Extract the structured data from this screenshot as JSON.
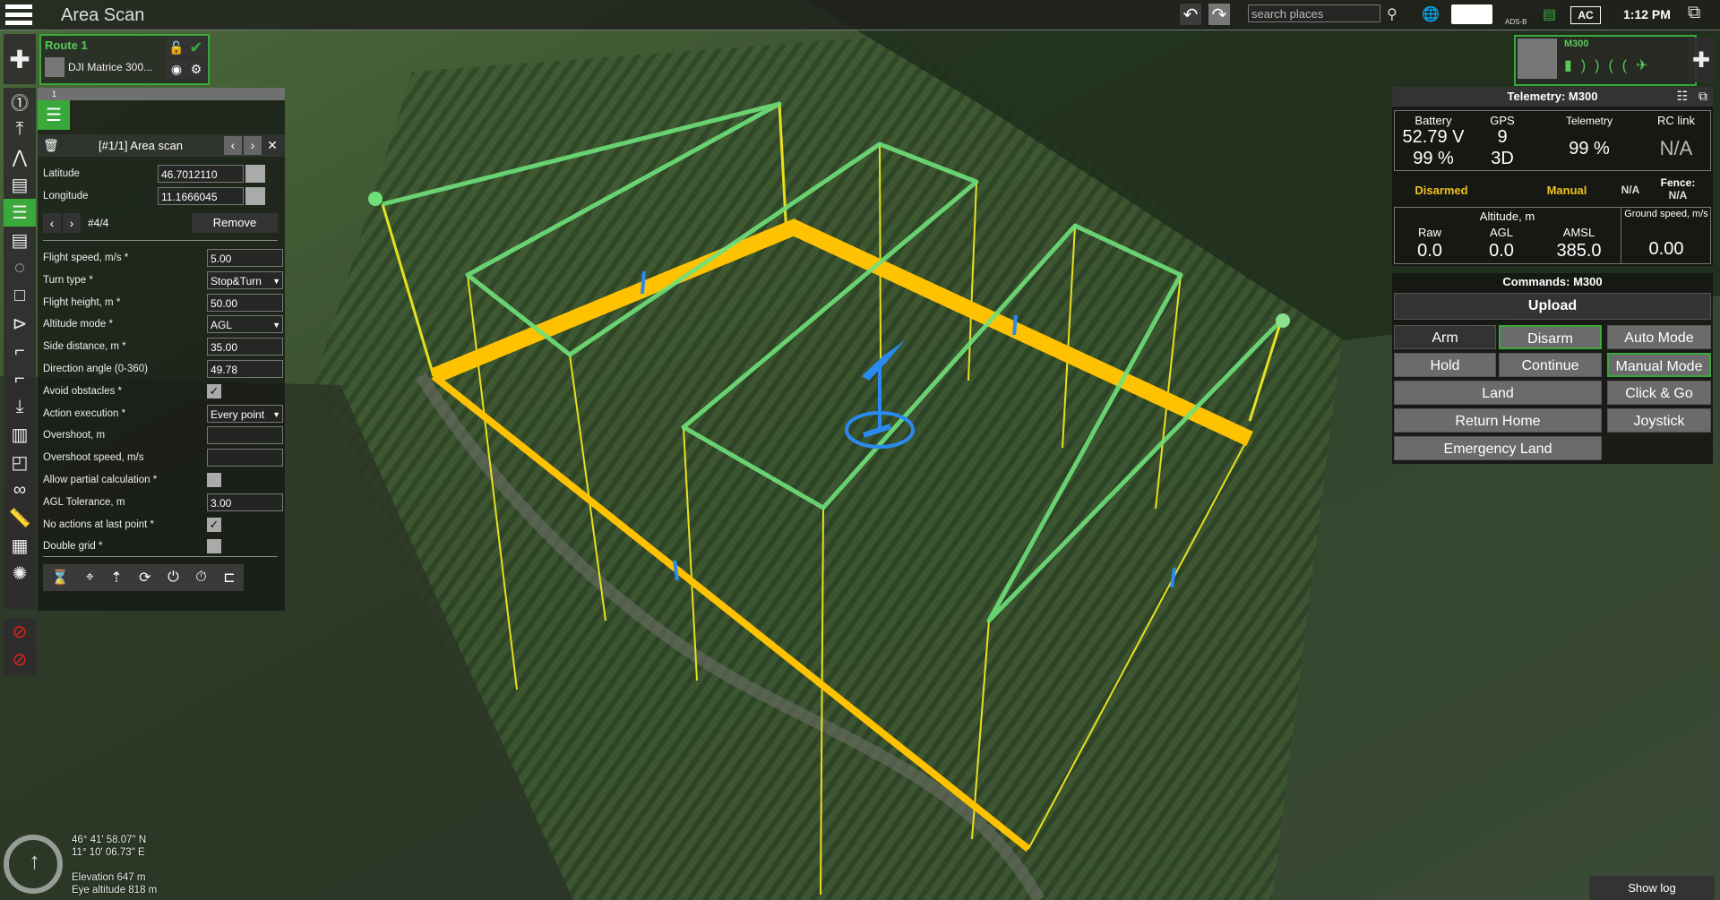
{
  "app": {
    "title": "Area Scan"
  },
  "topbar": {
    "search_placeholder": "search places",
    "ac_label": "AC",
    "time": "1:12 PM",
    "icons": [
      "undo-icon",
      "redo-icon",
      "search-icon",
      "globe-icon",
      "keyboard-icon",
      "adsb-icon",
      "checklist-icon",
      "battery-ac-icon",
      "mission-hub-icon"
    ],
    "adsb_label": "ADS-B"
  },
  "route": {
    "name": "Route 1",
    "drone": "DJI Matrice 300..."
  },
  "left_tools": [
    "add-route",
    "waypoint-1",
    "takeoff",
    "polyline",
    "area-scan-photo",
    "area-scan",
    "area-scan-lidar",
    "circle",
    "rectangle",
    "facade-scan",
    "corridor-photo",
    "corridor-lidar",
    "landing",
    "grid-scan",
    "spiral",
    "double-circle",
    "ruler",
    "overlay",
    "light",
    "no-fly-zone-square",
    "no-fly-zone-circle"
  ],
  "panel": {
    "tab_index": "1",
    "title": "[#1/1] Area scan",
    "latitude_label": "Latitude",
    "latitude": "46.7012110",
    "longitude_label": "Longitude",
    "longitude": "11.1666045",
    "point_counter": "#4/4",
    "remove_label": "Remove",
    "fields": [
      {
        "label": "Flight speed, m/s *",
        "value": "5.00",
        "type": "text"
      },
      {
        "label": "Turn type *",
        "value": "Stop&Turn",
        "type": "select"
      },
      {
        "label": "Flight height, m *",
        "value": "50.00",
        "type": "text"
      },
      {
        "label": "Altitude mode *",
        "value": "AGL",
        "type": "select"
      },
      {
        "label": "Side distance, m *",
        "value": "35.00",
        "type": "text"
      },
      {
        "label": "Direction angle (0-360)",
        "value": "49.78",
        "type": "text"
      },
      {
        "label": "Avoid obstacles *",
        "value": true,
        "type": "checkbox"
      },
      {
        "label": "Action execution *",
        "value": "Every point",
        "type": "select"
      },
      {
        "label": "Overshoot, m",
        "value": "",
        "type": "text"
      },
      {
        "label": "Overshoot speed, m/s",
        "value": "",
        "type": "text"
      },
      {
        "label": "Allow partial calculation *",
        "value": false,
        "type": "checkbox"
      },
      {
        "label": "AGL Tolerance, m",
        "value": "3.00",
        "type": "text"
      },
      {
        "label": "No actions at last point *",
        "value": true,
        "type": "checkbox"
      },
      {
        "label": "Double grid *",
        "value": false,
        "type": "checkbox"
      }
    ],
    "actions": [
      "hourglass-icon",
      "camera-target-icon",
      "altitude-change-icon",
      "camera-rotate-icon",
      "camera-start-icon",
      "camera-timer-icon",
      "camera-distance-icon"
    ]
  },
  "geo": {
    "lat": "46° 41' 58.07\" N",
    "lon": "11° 10' 06.73\" E",
    "elevation": "Elevation 647 m",
    "eye": "Eye altitude 818 m"
  },
  "drone_card": {
    "name": "M300"
  },
  "telemetry": {
    "title": "Telemetry: M300",
    "battery_label": "Battery",
    "battery_voltage": "52.79 V",
    "battery_percent": "99 %",
    "gps_label": "GPS",
    "gps_sats": "9",
    "gps_fix": "3D",
    "telemetry_label": "Telemetry",
    "telemetry_value": "99 %",
    "rc_label": "RC link",
    "rc_value": "N/A",
    "arm_state": "Disarmed",
    "mode": "Manual",
    "extra": "N/A",
    "fence_label": "Fence:",
    "fence_value": "N/A",
    "altitude_label": "Altitude, m",
    "raw_label": "Raw",
    "raw": "0.0",
    "agl_label": "AGL",
    "agl": "0.0",
    "amsl_label": "AMSL",
    "amsl": "385.0",
    "gs_label": "Ground speed, m/s",
    "gs": "0.00"
  },
  "commands": {
    "title": "Commands: M300",
    "upload": "Upload",
    "arm": "Arm",
    "disarm": "Disarm",
    "auto": "Auto Mode",
    "hold": "Hold",
    "cont": "Continue",
    "manual": "Manual Mode",
    "land": "Land",
    "clickgo": "Click & Go",
    "rth": "Return Home",
    "joystick": "Joystick",
    "emergency": "Emergency Land"
  },
  "showlog": "Show log",
  "colors": {
    "accent": "#3aa83a",
    "route_orange": "#ffc200",
    "route_green": "#6fe07a",
    "vertical_yellow": "#e8e020",
    "status_yellow": "#f0c020",
    "drone_blue": "#2a8af0"
  }
}
